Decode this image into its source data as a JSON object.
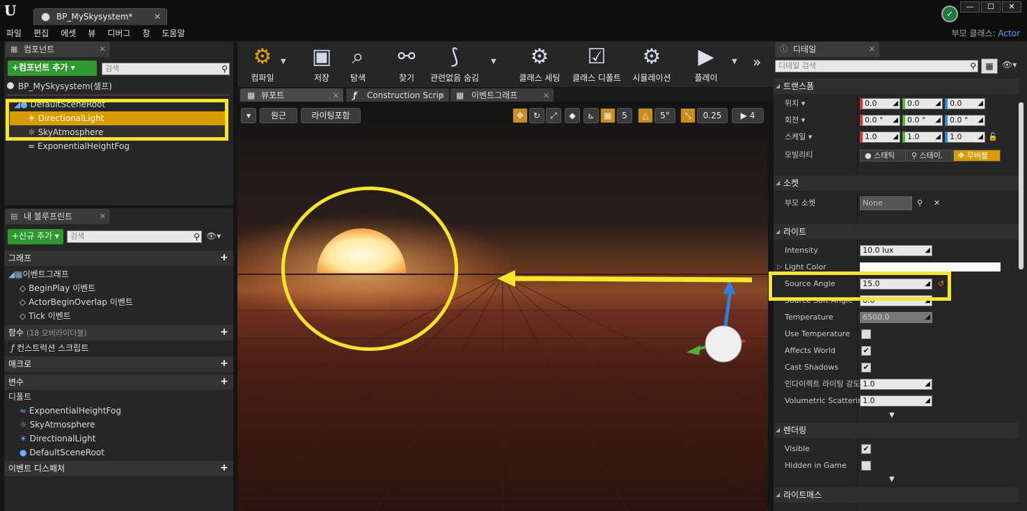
{
  "window": {
    "tab_title": "BP_MySkysystem*",
    "parent_class_label": "부모 클래스:",
    "parent_class_value": "Actor",
    "close": "✕"
  },
  "menu": [
    "파일",
    "편집",
    "에셋",
    "뷰",
    "디버그",
    "창",
    "도움말"
  ],
  "components": {
    "tab": "컴포넌트",
    "add_button": "+컴포넌트 추가 ▾",
    "search_placeholder": "검색",
    "self_item": "BP_MySkysystem(셀프)",
    "items": [
      "DefaultSceneRoot",
      "DirectionalLight",
      "SkyAtmosphere",
      "ExponentialHeightFog"
    ]
  },
  "blueprint": {
    "tab": "내 블루프린트",
    "add_button": "+신규 추가 ▾",
    "search_placeholder": "검색",
    "graph": "그래프",
    "eventgraph": "이벤트그래프",
    "events": [
      "BeginPlay 이벤트",
      "ActorBeginOverlap 이벤트",
      "Tick 이벤트"
    ],
    "functions": "함수",
    "functions_note": "(18 오버라이더블)",
    "construction": "컨스트럭션 스크립트",
    "macros": "매크로",
    "variables": "변수",
    "defaults": "디폴트",
    "vars": [
      "ExponentialHeightFog",
      "SkyAtmosphere",
      "DirectionalLight",
      "DefaultSceneRoot"
    ],
    "dispatchers": "이벤트 디스패처"
  },
  "toolbar": {
    "items": [
      "컴파일",
      "저장",
      "탐색",
      "찾기",
      "관련없음 숨김",
      "클래스 세팅",
      "클래스 디폴트",
      "시뮬레이션",
      "플레이"
    ]
  },
  "view_tabs": [
    "뷰포트",
    "Construction Scrip",
    "이벤트그래프"
  ],
  "viewport": {
    "perspective": "원근",
    "lighting": "라이팅포함",
    "grid_snap": "5",
    "rot_snap": "5°",
    "scale_snap": "0.25",
    "cam_speed": "4"
  },
  "details": {
    "tab": "디테일",
    "search_placeholder": "디테일 검색",
    "transform": "트랜스폼",
    "location": "위치 ▾",
    "rotation": "회전 ▾",
    "scale": "스케일 ▾",
    "mobility": "모빌리티",
    "loc": [
      "0.0",
      "0.0",
      "0.0"
    ],
    "rot": [
      "0.0 °",
      "0.0 °",
      "0.0 °"
    ],
    "scl": [
      "1.0",
      "1.0",
      "1.0"
    ],
    "mob": [
      "스태틱",
      "스테이.",
      "무버블"
    ],
    "sockets": "소켓",
    "parent_socket": "부모 소켓",
    "parent_socket_value": "None",
    "light": "라이트",
    "intensity": "Intensity",
    "intensity_v": "10.0 lux",
    "light_color": "Light Color",
    "source_angle": "Source Angle",
    "source_angle_v": "15.0",
    "source_soft": "Source Soft Angle",
    "source_soft_v": "0.0",
    "temperature": "Temperature",
    "temperature_v": "6500.0",
    "use_temp": "Use Temperature",
    "affects": "Affects World",
    "cast": "Cast Shadows",
    "indirect": "인다이렉트 라이팅 강도",
    "indirect_v": "1.0",
    "volumetric": "Volumetric Scatterin",
    "volumetric_v": "1.0",
    "rendering": "렌더링",
    "visible": "Visible",
    "hidden": "Hidden in Game",
    "lightmass": "라이트매스"
  }
}
